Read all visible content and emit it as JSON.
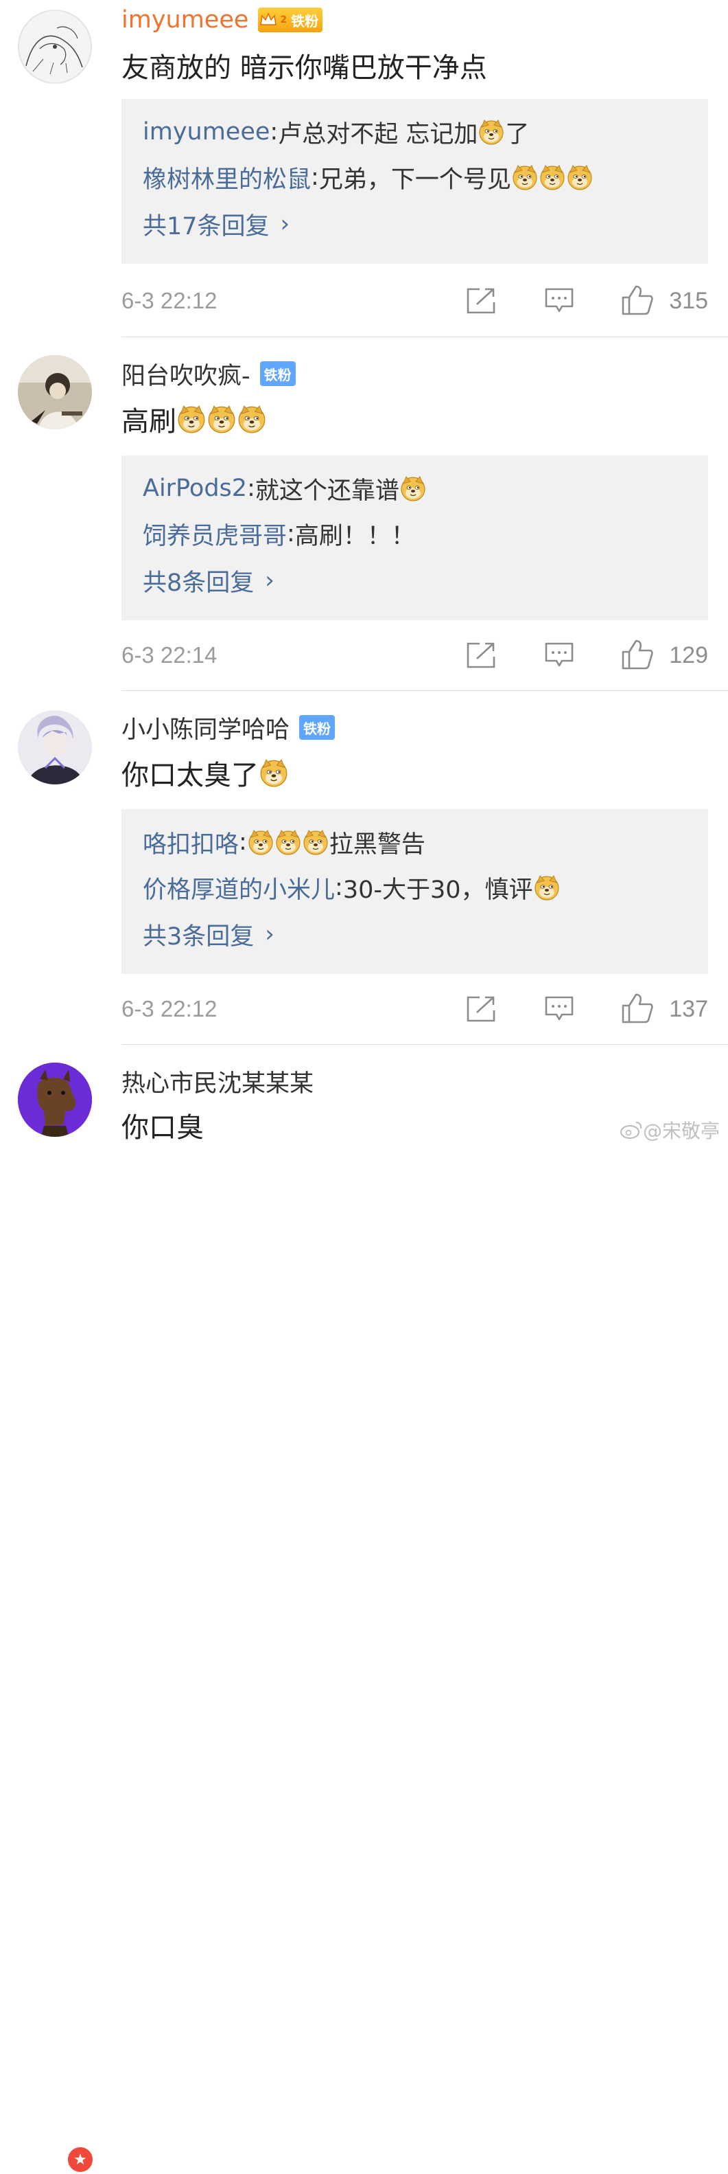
{
  "comments": [
    {
      "username": "imyumeee",
      "badge": "铁粉",
      "vip_level": "2",
      "text": "友商放的 暗示你嘴巴放干净点",
      "replies": [
        {
          "name": "imyumeee",
          "text": "卢总对不起 忘记加",
          "emojis_after": 1,
          "suffix": "了"
        },
        {
          "name": "橡树林里的松鼠",
          "text": "兄弟，下一个号见",
          "emojis_after": 3,
          "suffix": ""
        }
      ],
      "more": "共17条回复",
      "time": "6-3 22:12",
      "likes": "315"
    },
    {
      "username": "阳台吹吹疯-",
      "badge": "铁粉",
      "text": "高刷",
      "text_emojis": 3,
      "replies": [
        {
          "name": "AirPods2",
          "text": "就这个还靠谱",
          "emojis_after": 1,
          "suffix": ""
        },
        {
          "name": "饲养员虎哥哥",
          "text": "高刷！！！",
          "emojis_after": 0,
          "suffix": ""
        }
      ],
      "more": "共8条回复",
      "time": "6-3 22:14",
      "likes": "129"
    },
    {
      "username": "小小陈同学哈哈",
      "badge": "铁粉",
      "text": "你口太臭了",
      "text_emojis": 1,
      "replies": [
        {
          "name": "咯扣扣咯",
          "text": "",
          "emojis_after": 3,
          "suffix": "拉黑警告"
        },
        {
          "name": "价格厚道的小米儿",
          "text": "30-大于30，慎评",
          "emojis_after": 1,
          "suffix": ""
        }
      ],
      "more": "共3条回复",
      "time": "6-3 22:12",
      "likes": "137"
    },
    {
      "username": "热心市民沈某某某",
      "text": "你口臭"
    }
  ],
  "ui": {
    "separator": ": ",
    "more_arrow": "›",
    "watermark": "@宋敬亭",
    "colors": {
      "link": "#4a6c98",
      "vip_name": "#f0742e",
      "badge": "#5ea6ff",
      "reply_bg": "#f1f1f1"
    },
    "icons": [
      "share-icon",
      "comment-icon",
      "like-icon",
      "doge-emoji",
      "crown-icon"
    ]
  }
}
